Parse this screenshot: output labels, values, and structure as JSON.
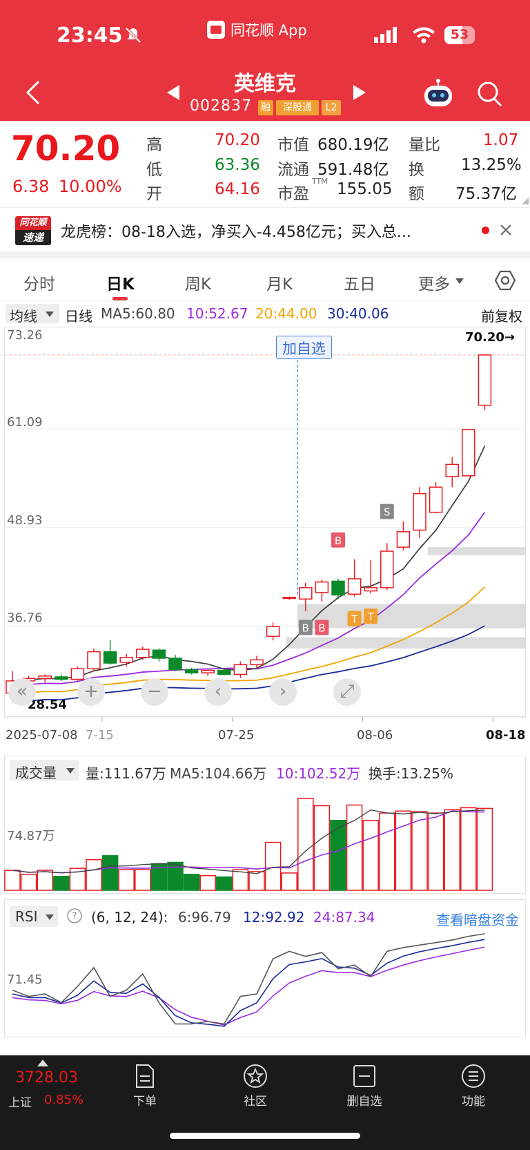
{
  "status": {
    "time": "23:45",
    "battery": "53"
  },
  "app": {
    "name": "同花顺 App"
  },
  "stock": {
    "name": "英维克",
    "code": "002837",
    "tags": [
      "融",
      "深股通",
      "L2"
    ]
  },
  "quote": {
    "price": "70.20",
    "change": "6.38",
    "pct": "10.00%",
    "high_l": "高",
    "high": "70.20",
    "low_l": "低",
    "low": "63.36",
    "open_l": "开",
    "open": "64.16",
    "mcap_l": "市值",
    "mcap": "680.19亿",
    "float_l": "流通",
    "float": "591.48亿",
    "pe_l": "市盈",
    "pe_sup": "TTM",
    "pe": "155.05",
    "vr_l": "量比",
    "vr": "1.07",
    "turn_l": "换",
    "turn": "13.25%",
    "amt_l": "额",
    "amt": "75.37亿"
  },
  "news": {
    "badge_top": "同花顺",
    "badge_bottom": "速递",
    "text": "龙虎榜：08-18入选，净买入-4.458亿元；买入总..."
  },
  "tabs": [
    "分时",
    "日K",
    "周K",
    "月K",
    "五日",
    "更多"
  ],
  "kline": {
    "ma_type": "均线",
    "period": "日线",
    "ma5": "MA5:60.80",
    "ma10": "10:52.67",
    "ma20": "20:44.00",
    "ma30": "30:40.06",
    "adj": "前复权",
    "y_labels": [
      "73.26",
      "61.09",
      "48.93",
      "36.76"
    ],
    "low_label": "28.54",
    "last_label": "70.20→",
    "add_watch": "加自选",
    "x_labels": [
      "2025-07-08",
      "7-15",
      "07-25",
      "08-06",
      "08-18"
    ],
    "markers": [
      "B",
      "B",
      "B",
      "S",
      "T",
      "T"
    ]
  },
  "volume": {
    "selector": "成交量",
    "vol": "量:111.67万",
    "ma5": "MA5:104.66万",
    "ma10": "10:102.52万",
    "turn": "换手:13.25%",
    "y_label": "74.87万"
  },
  "rsi": {
    "selector": "RSI",
    "params": "(6, 12, 24):",
    "r6": "6:96.79",
    "r12": "12:92.92",
    "r24": "24:87.34",
    "link": "查看暗盘资金",
    "y_label": "71.45"
  },
  "bottom": {
    "index_value": "3728.03",
    "index_name": "上证",
    "index_pct": "0.85%",
    "nav": [
      "下单",
      "社区",
      "删自选",
      "功能"
    ]
  },
  "colors": {
    "brand": "#e8343e",
    "up": "#e8181e",
    "down": "#0a8a2a",
    "ma5": "#444444",
    "ma10": "#9a2be0",
    "ma20": "#f0a500",
    "ma30": "#1a2a9a"
  },
  "chart_data": {
    "type": "candlestick",
    "dates_labeled": [
      "2025-07-08",
      "07-15",
      "07-25",
      "08-06",
      "08-18"
    ],
    "ohlc": [
      [
        28.5,
        31.2,
        28.6,
        30.0
      ],
      [
        30.0,
        30.6,
        29.6,
        30.3
      ],
      [
        30.3,
        30.8,
        29.8,
        30.6
      ],
      [
        30.5,
        30.8,
        30.0,
        30.2
      ],
      [
        30.2,
        31.8,
        30.0,
        31.5
      ],
      [
        31.5,
        34.0,
        31.2,
        33.6
      ],
      [
        33.6,
        35.0,
        32.0,
        32.2
      ],
      [
        32.3,
        33.3,
        31.8,
        32.9
      ],
      [
        32.9,
        34.2,
        32.6,
        33.9
      ],
      [
        33.8,
        34.0,
        32.4,
        32.8
      ],
      [
        32.8,
        33.2,
        31.2,
        31.4
      ],
      [
        31.4,
        31.6,
        30.8,
        31.0
      ],
      [
        31.0,
        31.5,
        30.6,
        31.3
      ],
      [
        31.3,
        31.5,
        30.7,
        30.8
      ],
      [
        30.8,
        32.4,
        30.4,
        32.0
      ],
      [
        32.0,
        33.1,
        31.6,
        32.6
      ],
      [
        35.5,
        37.2,
        35.0,
        36.7
      ],
      [
        40.2,
        40.4,
        40.0,
        40.3
      ],
      [
        40.1,
        42.1,
        38.6,
        41.5
      ],
      [
        40.9,
        42.5,
        39.8,
        42.2
      ],
      [
        42.3,
        42.6,
        40.1,
        40.6
      ],
      [
        40.7,
        45.0,
        40.4,
        42.6
      ],
      [
        41.1,
        44.9,
        40.8,
        41.5
      ],
      [
        41.5,
        47.0,
        41.2,
        46.0
      ],
      [
        46.5,
        49.7,
        46.1,
        48.4
      ],
      [
        48.6,
        53.9,
        47.6,
        53.1
      ],
      [
        50.8,
        54.5,
        50.7,
        53.9
      ],
      [
        55.2,
        57.6,
        53.9,
        56.7
      ],
      [
        55.3,
        61.0,
        55.3,
        61.0
      ],
      [
        64.0,
        70.2,
        63.4,
        70.2
      ]
    ],
    "volume": [
      30,
      24,
      30,
      21,
      33,
      46,
      52,
      31,
      31,
      40,
      42,
      24,
      22,
      20,
      31,
      28,
      72,
      26,
      138,
      127,
      105,
      128,
      105,
      116,
      119,
      118,
      116,
      121,
      124,
      123
    ],
    "rsi6": [
      65,
      60,
      62,
      55,
      68,
      83,
      60,
      65,
      78,
      55,
      38,
      38,
      40,
      38,
      60,
      62,
      90,
      96,
      92,
      95,
      82,
      85,
      76,
      96,
      99,
      101,
      103,
      105,
      108,
      110
    ],
    "y_range": [
      28.54,
      73.26
    ]
  }
}
